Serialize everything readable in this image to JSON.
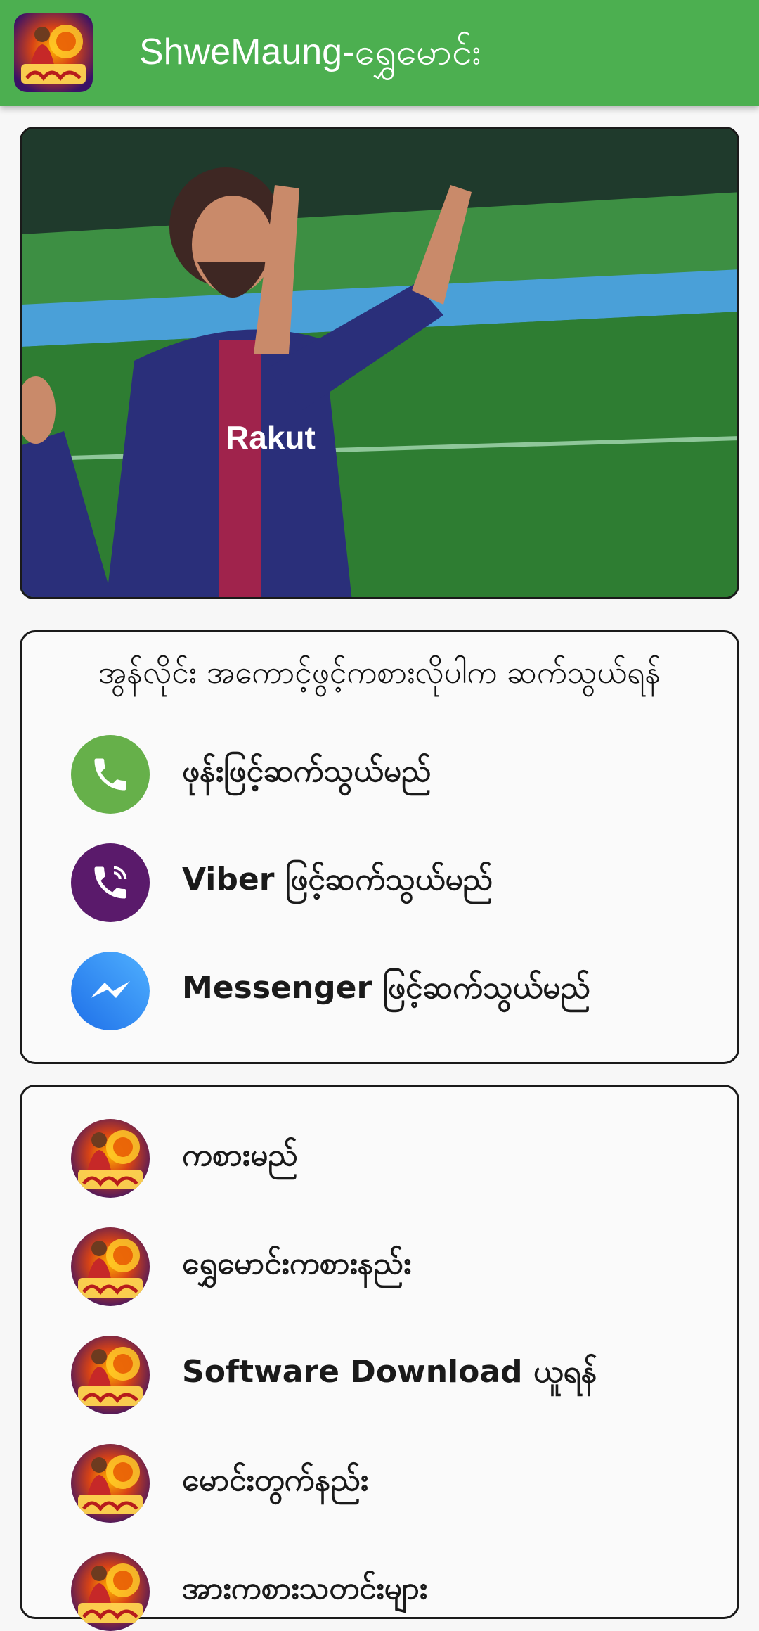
{
  "app_bar": {
    "title": "ShweMaung-ရွှေမောင်း",
    "logo_icon": "shwemaung-logo-icon",
    "background": "#4caf50"
  },
  "hero": {
    "image_name": "football-player-celebration-image"
  },
  "contact": {
    "heading": "အွန်လိုင်း အကောင့်ဖွင့်ကစားလိုပါက ဆက်သွယ်ရန်",
    "items": [
      {
        "label": "ဖုန်းဖြင့်ဆက်သွယ်မည်",
        "icon": "phone-icon",
        "color": "#66b04a"
      },
      {
        "label": "Viber ဖြင့်ဆက်သွယ်မည်",
        "icon": "viber-icon",
        "color": "#5a1a6b"
      },
      {
        "label": "Messenger ဖြင့်ဆက်သွယ်မည်",
        "icon": "messenger-icon",
        "color": "#2f8cf2"
      }
    ]
  },
  "menu": {
    "items": [
      {
        "label": "ကစားမည်",
        "icon": "shwemaung-logo-icon"
      },
      {
        "label": "ရွှေမောင်းကစားနည်း",
        "icon": "shwemaung-logo-icon"
      },
      {
        "label": "Software Download ယူရန်",
        "icon": "shwemaung-logo-icon"
      },
      {
        "label": "မောင်းတွက်နည်း",
        "icon": "shwemaung-logo-icon"
      },
      {
        "label": "အားကစားသတင်းများ",
        "icon": "shwemaung-logo-icon"
      }
    ]
  }
}
